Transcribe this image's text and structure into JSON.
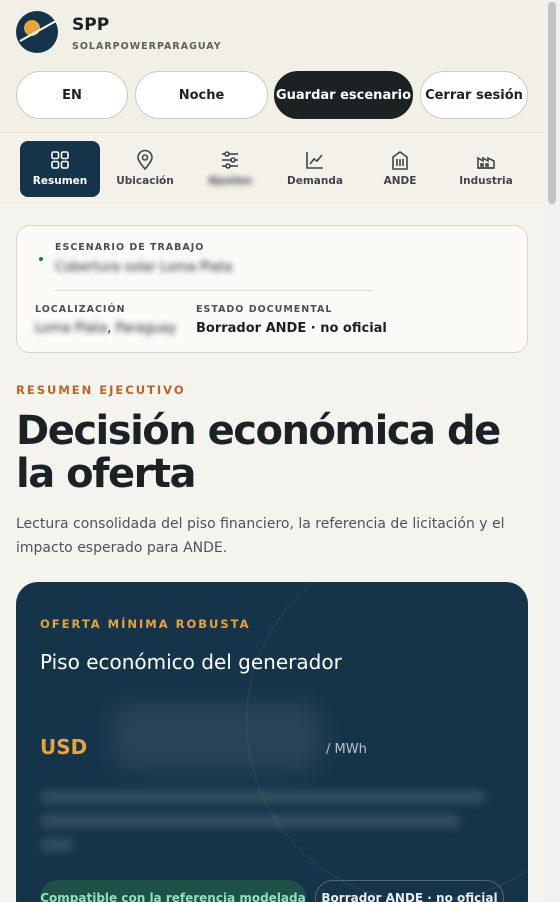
{
  "brand": {
    "name": "SPP",
    "subtitle": "SOLARPOWERPARAGUAY"
  },
  "toolbar": {
    "language_label": "EN",
    "theme_label": "Noche",
    "save_label": "Guardar escenario",
    "logout_label": "Cerrar sesión"
  },
  "tabs": [
    {
      "label": "Resumen",
      "icon": "grid-icon",
      "active": true
    },
    {
      "label": "Ubicación",
      "icon": "location-pin-icon"
    },
    {
      "label": "Ajustes",
      "icon": "sliders-icon"
    },
    {
      "label": "Demanda",
      "icon": "line-chart-icon"
    },
    {
      "label": "ANDE",
      "icon": "building-icon"
    },
    {
      "label": "Industria",
      "icon": "factory-icon"
    }
  ],
  "scenario": {
    "label": "ESCENARIO DE TRABAJO",
    "value": "Cobertura solar Loma Plata",
    "location_label": "LOCALIZACIÓN",
    "location_place": "Loma Plata",
    "location_country": "Paraguay",
    "status_label": "ESTADO DOCUMENTAL",
    "status_value": "Borrador ANDE · no oficial"
  },
  "summary": {
    "eyebrow": "RESUMEN EJECUTIVO",
    "title": "Decisión económica de la oferta",
    "lead": "Lectura consolidada del piso financiero, la referencia de licitación y el impacto esperado para ANDE."
  },
  "hero": {
    "eyebrow": "OFERTA MÍNIMA ROBUSTA",
    "title": "Piso económico del generador",
    "currency": "USD",
    "unit": "/ MWh",
    "chip_compatible": "Compatible con la referencia modelada",
    "chip_status": "Borrador ANDE · no oficial"
  },
  "colors": {
    "accent_navy": "#15344a",
    "accent_orange": "#b8642a",
    "accent_gold": "#e8a33c",
    "status_green": "#1e7f56"
  }
}
